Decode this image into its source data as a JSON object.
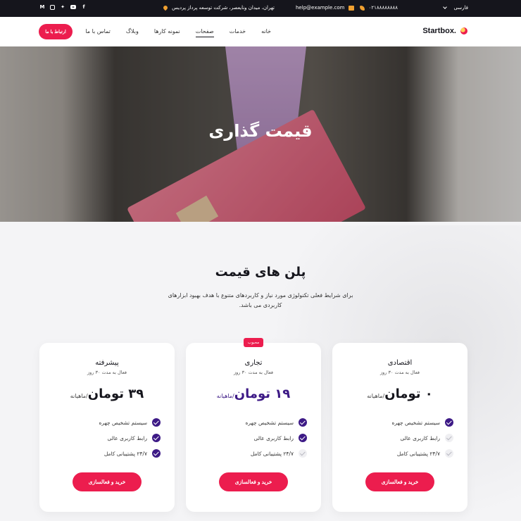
{
  "topbar": {
    "language": "فارسی",
    "phone": "۰۲۱۸۸۸۸۸۸۸۸",
    "email": "help@example.com",
    "address": "تهران، میدان ونایعصر، شرکت توسعه پرداز پردیس",
    "social": [
      "facebook-icon",
      "youtube-icon",
      "twitter-icon",
      "instagram-icon",
      "medium-icon"
    ]
  },
  "nav": {
    "logo": "Startbox.",
    "items": [
      "خانه",
      "خدمات",
      "صفحات",
      "نمونه کارها",
      "وبلاگ",
      "تماس با ما"
    ],
    "active_index": 2,
    "contact_button": "ارتباط با ما"
  },
  "hero": {
    "title": "قیمت گذاری"
  },
  "section": {
    "title": "پلن های قیمت",
    "description": "برای شرایط فعلی تکنولوژی مورد نیاز و کاربردهای متنوع با هدف بهبود ابزارهای کاربردی می باشد."
  },
  "plans": [
    {
      "name": "اقتصادی",
      "subtitle": "فعال به مدت ۳۰ روز",
      "price": "۰ تومان",
      "per": "/ماهیانه",
      "features": [
        {
          "text": "سیستم تشخیص چهره",
          "enabled": true
        },
        {
          "text": "رابط کاربری عالی",
          "enabled": false
        },
        {
          "text": "۲۴/۷ پشتیبانی کامل",
          "enabled": false
        }
      ],
      "button": "خرید و فعالسازی"
    },
    {
      "name": "تجاری",
      "subtitle": "فعال به مدت ۳۰ روز",
      "price": "۱۹ تومان",
      "per": "/ماهیانه",
      "badge": "محبوب",
      "features": [
        {
          "text": "سیستم تشخیص چهره",
          "enabled": true
        },
        {
          "text": "رابط کاربری عالی",
          "enabled": true
        },
        {
          "text": "۲۴/۷ پشتیبانی کامل",
          "enabled": false
        }
      ],
      "button": "خرید و فعالسازی"
    },
    {
      "name": "پیشرفته",
      "subtitle": "فعال به مدت ۳۰ روز",
      "price": "۳۹ تومان",
      "per": "/ماهیانه",
      "features": [
        {
          "text": "سیستم تشخیص چهره",
          "enabled": true
        },
        {
          "text": "رابط کاربری عالی",
          "enabled": true
        },
        {
          "text": "۲۴/۷ پشتیبانی کامل",
          "enabled": true
        }
      ],
      "button": "خرید و فعالسازی"
    }
  ],
  "colors": {
    "accent": "#ec1d4e",
    "purple": "#3d1a86",
    "dark": "#15151c"
  }
}
